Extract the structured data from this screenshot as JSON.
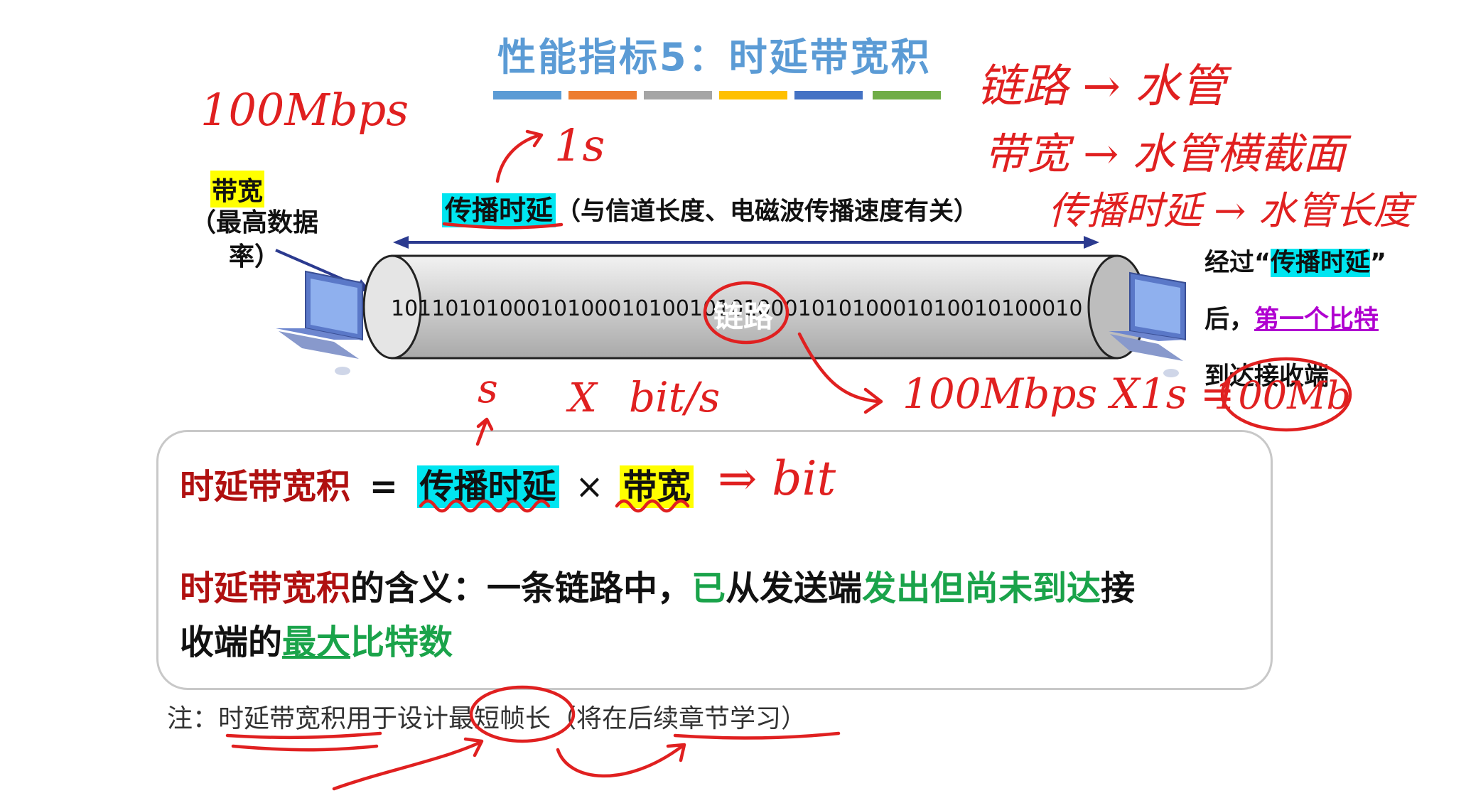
{
  "slide": {
    "title": "性能指标5：时延带宽积",
    "title_bar_colors": [
      "#5b9bd5",
      "#ed7d31",
      "#a5a5a5",
      "#ffc000",
      "#4472c4",
      "#70ad47"
    ],
    "bandwidth_label": "带宽",
    "bandwidth_sub": "（最高数据率）",
    "prop_delay_label": "传播时延",
    "prop_delay_note": "（与信道长度、电磁波传播速度有关）",
    "link_label": "链路",
    "bit_stream": "101101010001010001010010101000101010001010010100010",
    "right_note": {
      "line1_prefix": "经过“",
      "line1_highlight": "传播时延",
      "line1_suffix": "”",
      "line2_prefix": "后，",
      "line2_highlight": "第一个比特",
      "line3": "到达接收端"
    },
    "formula": {
      "lhs": "时延带宽积",
      "equals": "=",
      "term1": "传播时延",
      "times": "×",
      "term2": "带宽"
    },
    "meaning": {
      "lead": "时延带宽积",
      "part1": "的含义：一条链路中，",
      "part2": "已",
      "part3": "从发送端",
      "part4": "发出但尚未到达",
      "part5": "接",
      "part6": "收端的",
      "part7": "最大",
      "part8": "比特数"
    },
    "footnote": "注：时延带宽积用于设计最短帧长（将在后续章节学习）"
  },
  "annotations": {
    "bw_value": "100Mbps",
    "time_value": "1s",
    "pipe1": "链路 → 水管",
    "pipe2": "带宽 → 水管横截面",
    "pipe3": "传播时延 → 水管长度",
    "units_s": "s",
    "units_x": "X",
    "units_bits": "bit/s",
    "calc": "100Mbps X1s =",
    "calc_result": "100Mb",
    "arrow_bit": "⇒ bit"
  }
}
